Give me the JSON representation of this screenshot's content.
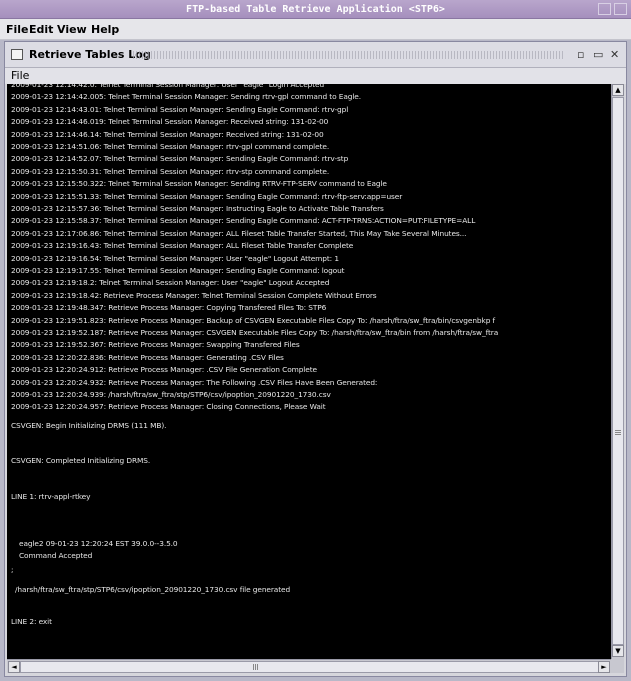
{
  "window": {
    "title": "FTP-based Table Retrieve Application <STP6>"
  },
  "menubar": {
    "items": [
      "File",
      "Edit",
      "View",
      "Help"
    ]
  },
  "log_window": {
    "title": "Retrieve Tables Log",
    "menu_file": "File",
    "lines": [
      "2009-01-23 12:14:42.0: Telnet Terminal Session Manager: User \"eagle\" Login Accepted",
      "2009-01-23 12:14:42.005: Telnet Terminal Session Manager: Sending rtrv-gpl command to Eagle.",
      "2009-01-23 12:14:43.01: Telnet Terminal Session Manager: Sending Eagle Command: rtrv-gpl",
      "2009-01-23 12:14:46.019: Telnet Terminal Session Manager: Received string: 131-02-00",
      "2009-01-23 12:14:46.14: Telnet Terminal Session Manager: Received string: 131-02-00",
      "2009-01-23 12:14:51.06: Telnet Terminal Session Manager: rtrv-gpl command complete.",
      "2009-01-23 12:14:52.07: Telnet Terminal Session Manager: Sending Eagle Command: rtrv-stp",
      "2009-01-23 12:15:50.31: Telnet Terminal Session Manager: rtrv-stp command complete.",
      "2009-01-23 12:15:50.322: Telnet Terminal Session Manager: Sending RTRV-FTP-SERV command to Eagle",
      "2009-01-23 12:15:51.33: Telnet Terminal Session Manager: Sending Eagle Command: rtrv-ftp-serv:app=user",
      "2009-01-23 12:15:57.36: Telnet Terminal Session Manager: Instructing Eagle to Activate Table Transfers",
      "2009-01-23 12:15:58.37: Telnet Terminal Session Manager: Sending Eagle Command: ACT-FTP-TRNS:ACTION=PUT:FILETYPE=ALL",
      "2009-01-23 12:17:06.86: Telnet Terminal Session Manager: ALL Fileset Table Transfer Started, This May Take Several Minutes...",
      "2009-01-23 12:19:16.43: Telnet Terminal Session Manager: ALL Fileset Table Transfer Complete",
      "2009-01-23 12:19:16.54: Telnet Terminal Session Manager: User \"eagle\" Logout Attempt: 1",
      "2009-01-23 12:19:17.55: Telnet Terminal Session Manager: Sending Eagle Command: logout",
      "2009-01-23 12:19:18.2: Telnet Terminal Session Manager: User \"eagle\" Logout Accepted",
      "2009-01-23 12:19:18.42: Retrieve Process Manager: Telnet Terminal Session Complete Without Errors",
      "2009-01-23 12:19:48.347: Retrieve Process Manager: Copying Transfered Files To: STP6",
      "2009-01-23 12:19:51.823: Retrieve Process Manager: Backup of CSVGEN Executable Files Copy To: /harsh/ftra/sw_ftra/bin/csvgenbkp f",
      "2009-01-23 12:19:52.187: Retrieve Process Manager: CSVGEN Executable Files Copy To: /harsh/ftra/sw_ftra/bin from /harsh/ftra/sw_ftra",
      "2009-01-23 12:19:52.367: Retrieve Process Manager: Swapping Transfered Files",
      "2009-01-23 12:20:22.836: Retrieve Process Manager: Generating .CSV Files",
      "2009-01-23 12:20:24.912: Retrieve Process Manager: .CSV File Generation Complete",
      "2009-01-23 12:20:24.932: Retrieve Process Manager: The Following .CSV Files Have Been Generated:",
      "2009-01-23 12:20:24.939:                    /harsh/ftra/sw_ftra/stp/STP6/csv/ipoption_20901220_1730.csv",
      "2009-01-23 12:20:24.957: Retrieve Process Manager: Closing Connections, Please Wait",
      "CSVGEN: Begin Initializing DRMS (111 MB).",
      "",
      "CSVGEN: Completed Initializing DRMS.",
      "",
      "LINE 1: rtrv-appl-rtkey",
      "",
      "    eagle2 09-01-23 12:20:24 EST  39.0.0--3.5.0",
      "    Command Accepted",
      ";",
      "  /harsh/ftra/sw_ftra/stp/STP6/csv/ipoption_20901220_1730.csv file generated",
      "",
      "LINE 2: exit"
    ]
  },
  "scrollbar": {
    "up": "▲",
    "down": "▼",
    "left": "◄",
    "right": "►"
  },
  "controls": {
    "float": "▫",
    "restore": "▭",
    "close": "✕"
  }
}
